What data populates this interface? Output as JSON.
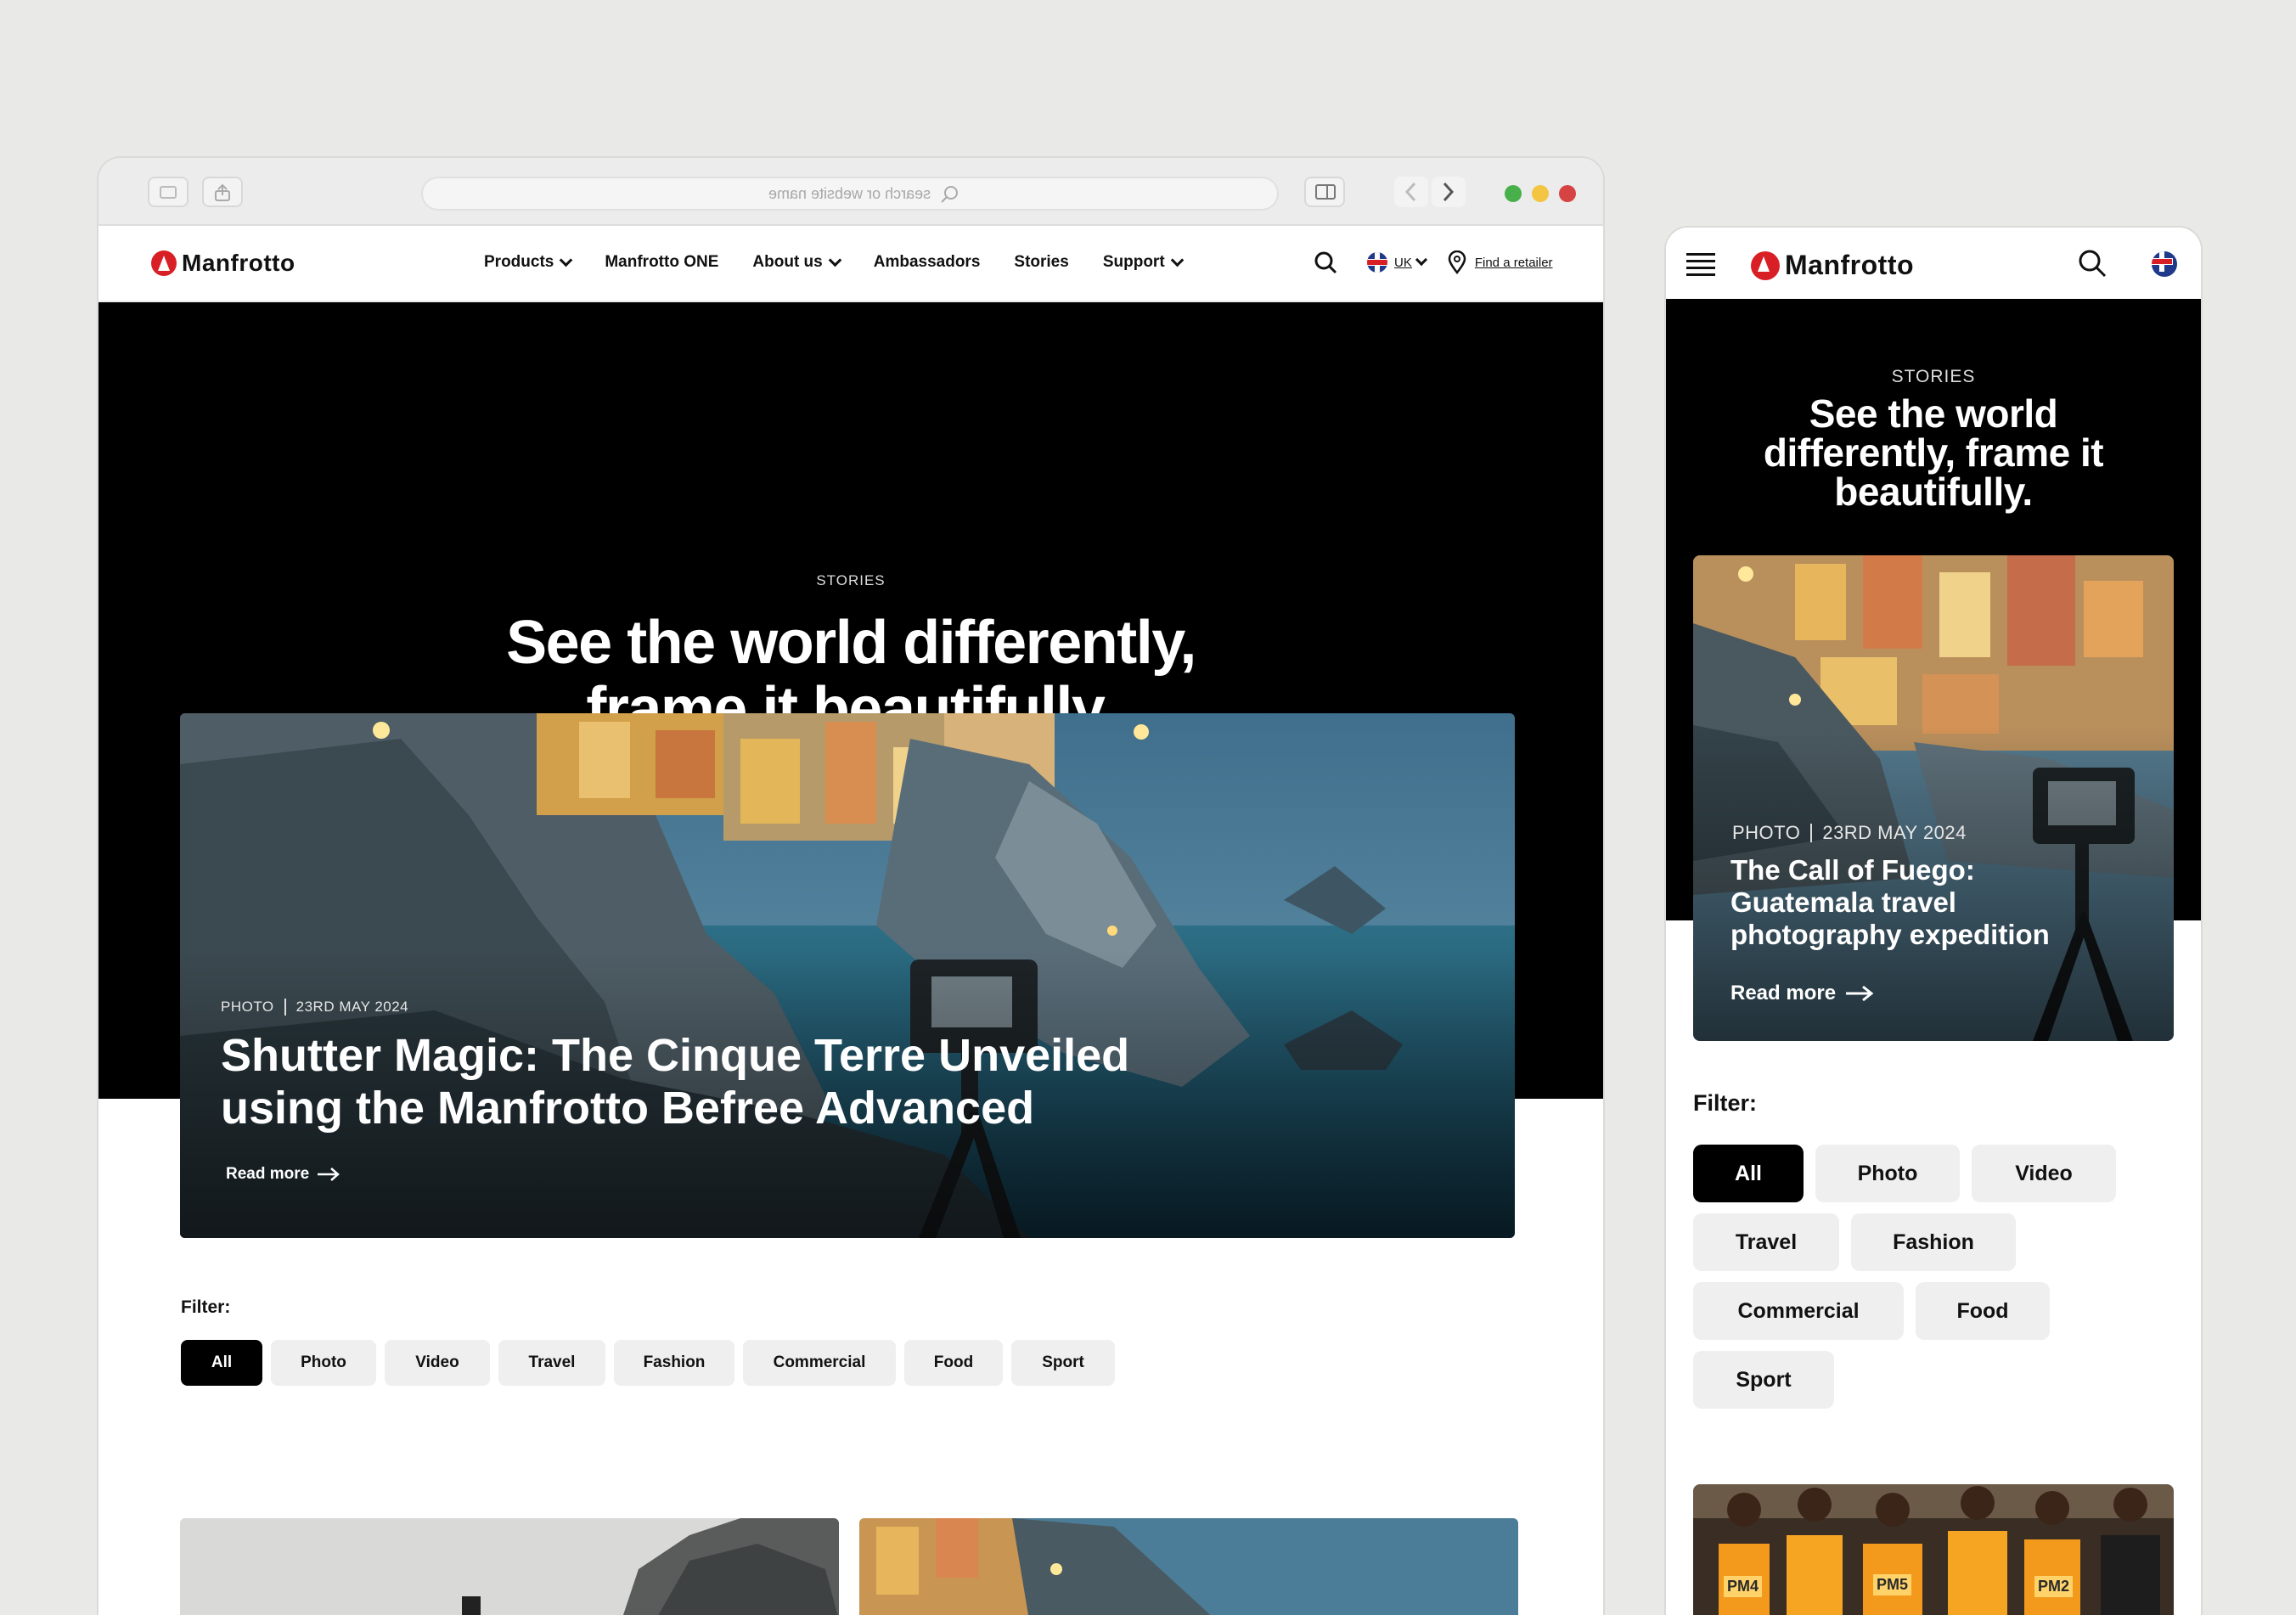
{
  "browser": {
    "address_placeholder": "search or website name",
    "traffic_lights": [
      "#48b04b",
      "#f4c543",
      "#d64343"
    ]
  },
  "site": {
    "logo": "Manfrotto",
    "nav": [
      {
        "label": "Products",
        "dropdown": true
      },
      {
        "label": "Manfrotto ONE",
        "dropdown": false
      },
      {
        "label": "About us",
        "dropdown": true
      },
      {
        "label": "Ambassadors",
        "dropdown": false
      },
      {
        "label": "Stories",
        "dropdown": false
      },
      {
        "label": "Support",
        "dropdown": true
      }
    ],
    "locale": "UK",
    "find_retailer": "Find a retailer"
  },
  "hero": {
    "kicker": "STORIES",
    "title_line1": "See the world differently,",
    "title_line2": "frame it beautifully."
  },
  "featured": {
    "category": "PHOTO",
    "date": "23RD MAY 2024",
    "title_line1": "Shutter Magic: The Cinque Terre Unveiled",
    "title_line2": "using the Manfrotto Befree Advanced",
    "read_more": "Read more"
  },
  "filter": {
    "label": "Filter:",
    "options": [
      "All",
      "Photo",
      "Video",
      "Travel",
      "Fashion",
      "Commercial",
      "Food",
      "Sport"
    ],
    "active": "All"
  },
  "mobile": {
    "hero": {
      "kicker": "STORIES",
      "title_line1": "See the world",
      "title_line2": "differently, frame it",
      "title_line3": "beautifully."
    },
    "featured": {
      "category": "PHOTO",
      "date": "23RD MAY 2024",
      "title_line1": "The Call of Fuego:",
      "title_line2": "Guatemala travel",
      "title_line3": "photography expedition",
      "read_more": "Read more"
    },
    "bib_numbers": [
      "PM4",
      "PM5",
      "PM2"
    ]
  },
  "colors": {
    "brand_red": "#d91f26",
    "black": "#000000",
    "chip_bg": "#efefef",
    "canvas": "#e9e9e7"
  }
}
